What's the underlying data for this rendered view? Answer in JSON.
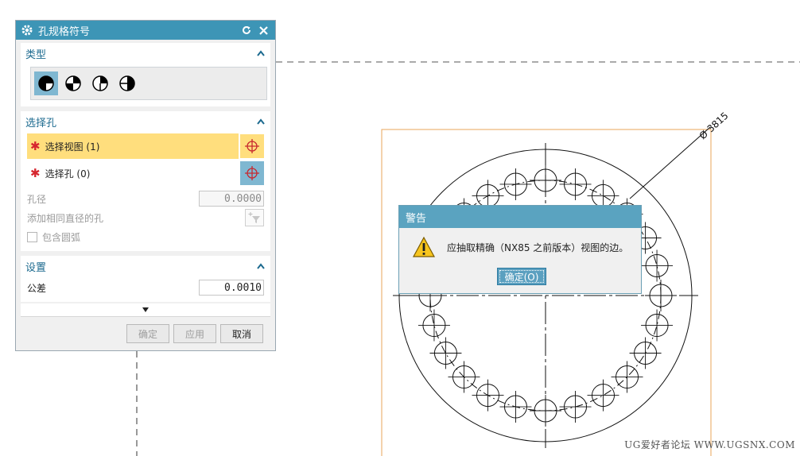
{
  "dialog": {
    "title": "孔规格符号",
    "type_section": {
      "label": "类型"
    },
    "select_section": {
      "label": "选择孔",
      "select_view": "选择视图 (1)",
      "select_hole": "选择孔 (0)",
      "hole_diameter_label": "孔径",
      "hole_diameter_value": "0.0000",
      "add_same_diameter_label": "添加相同直径的孔",
      "include_arc_label": "包含圆弧"
    },
    "settings_section": {
      "label": "设置",
      "tolerance_label": "公差",
      "tolerance_value": "0.0010"
    },
    "buttons": {
      "ok": "确定",
      "apply": "应用",
      "cancel": "取消"
    }
  },
  "warning": {
    "title": "警告",
    "message": "应抽取精确（NX85 之前版本）视图的边。",
    "ok": "确定(O)"
  },
  "drawing": {
    "dimension_text": "Ø 3815"
  },
  "watermark": "UG爱好者论坛 WWW.UGSNX.COM",
  "colors": {
    "accent": "#3d95b6",
    "highlight": "#ffde7d",
    "required": "#d6262e",
    "frame": "#e8a45a"
  }
}
